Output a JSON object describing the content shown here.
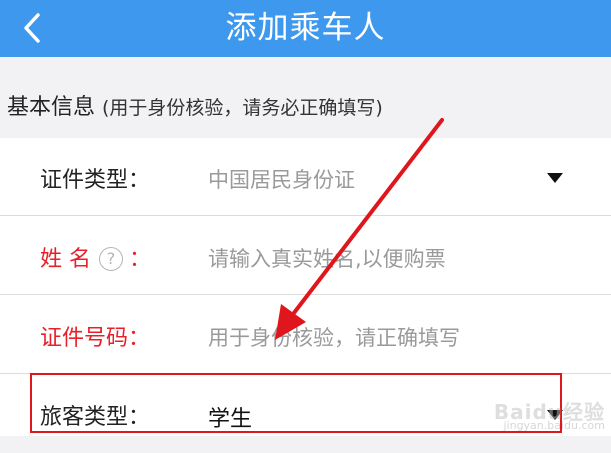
{
  "header": {
    "title": "添加乘车人",
    "back_icon": "chevron-left-icon"
  },
  "section": {
    "label": "基本信息",
    "note": "(用于身份核验，请务必正确填写)"
  },
  "form": {
    "id_type": {
      "label": "证件类型：",
      "value": "中国居民身份证"
    },
    "name": {
      "label_first": "姓",
      "label_second": "名",
      "help": "?",
      "colon": "：",
      "placeholder": "请输入真实姓名,以便购票"
    },
    "id_number": {
      "label": "证件号码：",
      "placeholder": "用于身份核验，请正确填写"
    },
    "passenger_type": {
      "label": "旅客类型：",
      "value": "学生"
    }
  },
  "colors": {
    "header_bg": "#3d98ee",
    "required_label": "#e8202a",
    "annotation": "#e0161d"
  },
  "watermark": {
    "brand": "Baidu经验",
    "url": "jingyan.baidu.com"
  }
}
